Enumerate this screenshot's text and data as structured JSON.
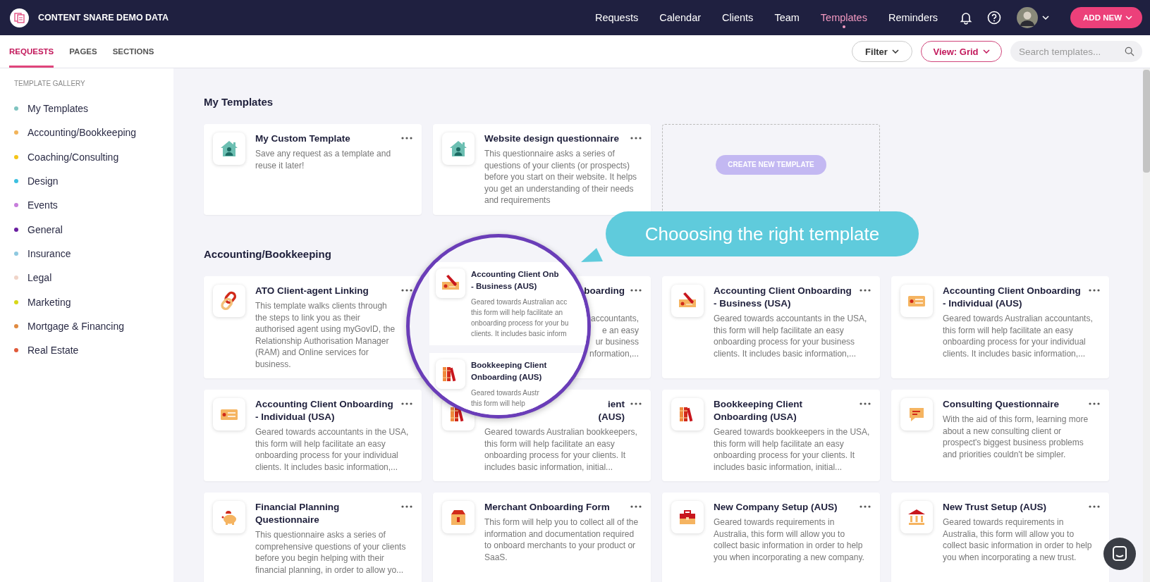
{
  "app": {
    "title": "CONTENT SNARE DEMO DATA"
  },
  "nav": [
    {
      "label": "Requests",
      "selected": false
    },
    {
      "label": "Calendar",
      "selected": false
    },
    {
      "label": "Clients",
      "selected": false
    },
    {
      "label": "Team",
      "selected": false
    },
    {
      "label": "Templates",
      "selected": true
    },
    {
      "label": "Reminders",
      "selected": false
    }
  ],
  "add_new_button": "ADD NEW",
  "sub_tabs": [
    {
      "label": "REQUESTS",
      "selected": true
    },
    {
      "label": "PAGES",
      "selected": false
    },
    {
      "label": "SECTIONS",
      "selected": false
    }
  ],
  "filter_button": "Filter",
  "view_button": "View: Grid",
  "search": {
    "placeholder": "Search templates..."
  },
  "sidebar": {
    "heading": "TEMPLATE GALLERY",
    "items": [
      {
        "label": "My Templates",
        "color": "#7fc4c0"
      },
      {
        "label": "Accounting/Bookkeeping",
        "color": "#f2b45a"
      },
      {
        "label": "Coaching/Consulting",
        "color": "#f5c518"
      },
      {
        "label": "Design",
        "color": "#3cc0e0"
      },
      {
        "label": "Events",
        "color": "#c77ddb"
      },
      {
        "label": "General",
        "color": "#6a1fa0"
      },
      {
        "label": "Insurance",
        "color": "#8ec9e0"
      },
      {
        "label": "Legal",
        "color": "#f0d4c8"
      },
      {
        "label": "Marketing",
        "color": "#d8d818"
      },
      {
        "label": "Mortgage & Financing",
        "color": "#e08a40"
      },
      {
        "label": "Real Estate",
        "color": "#e05a3a"
      }
    ]
  },
  "sections": [
    {
      "title": "My Templates",
      "create_button": "CREATE NEW TEMPLATE",
      "cards": [
        {
          "kind": "full",
          "title": "My Custom Template",
          "description": "Save any request as a template and reuse it later!"
        },
        {
          "kind": "full",
          "title": "Website design questionnaire",
          "description": "This questionnaire asks a series of questions of your clients (or prospects) before you start on their website. It helps you get an understanding of their needs and requirements"
        }
      ]
    },
    {
      "title": "Accounting/Bookkeeping",
      "cards": [
        {
          "kind": "full",
          "title": "ATO Client-agent Linking",
          "description": "This template walks clients through the steps to link you as their authorised agent using myGovID, the Relationship Authorisation Manager (RAM) and Online services for business."
        },
        {
          "kind": "covered",
          "title_lines": [
            "boarding"
          ],
          "description_lines": [
            "accountants,",
            "e an easy",
            "ur business",
            "nformation,..."
          ]
        },
        {
          "kind": "full",
          "title": "Accounting Client Onboarding - Business (USA)",
          "description": "Geared towards accountants in the USA, this form will help facilitate an easy onboarding process for your business clients. It includes basic information,..."
        },
        {
          "kind": "full",
          "title": "Accounting Client Onboarding - Individual (AUS)",
          "description": "Geared towards Australian accountants, this form will help facilitate an easy onboarding process for your individual clients. It includes basic information,..."
        },
        {
          "kind": "full",
          "title": "Accounting Client Onboarding - Individual (USA)",
          "description": "Geared towards accountants in the USA, this form will help facilitate an easy onboarding process for your individual clients. It includes basic information,..."
        },
        {
          "kind": "covered",
          "title_lines": [
            "ient",
            "(AUS)"
          ],
          "description": "Geared towards Australian bookkeepers, this form will help facilitate an easy onboarding process for your clients. It includes basic information, initial..."
        },
        {
          "kind": "full",
          "title": "Bookkeeping Client Onboarding (USA)",
          "description": "Geared towards bookkeepers in the USA, this form will help facilitate an easy onboarding process for your clients. It includes basic information, initial..."
        },
        {
          "kind": "full",
          "title": "Consulting Questionnaire",
          "description": "With the aid of this form, learning more about a new consulting client or prospect's biggest business problems and priorities couldn't be simpler."
        },
        {
          "kind": "full",
          "title": "Financial Planning Questionnaire",
          "description": "This questionnaire asks a series of comprehensive questions of your clients before you begin helping with their financial planning, in order to allow yo..."
        },
        {
          "kind": "full",
          "title": "Merchant Onboarding Form",
          "description": "This form will help you to collect all of the information and documentation required to onboard merchants to your product or SaaS."
        },
        {
          "kind": "full",
          "title": "New Company Setup (AUS)",
          "description": "Geared towards requirements in Australia, this form will allow you to collect basic information in order to help you when incorporating a new company."
        },
        {
          "kind": "full",
          "title": "New Trust Setup (AUS)",
          "description": "Geared towards requirements in Australia, this form will allow you to collect basic information in order to help you when incorporating a new trust."
        }
      ]
    }
  ],
  "callout": "Chooosing the right template",
  "magnifier": {
    "cards": [
      {
        "title_lines": [
          "Accounting Client Onb",
          "- Business (AUS)"
        ],
        "description_lines": [
          "Geared towards Australian acc",
          "this form will help facilitate an",
          "onboarding process for your bu",
          "clients. It includes basic inform"
        ]
      },
      {
        "title_lines": [
          "Bookkeeping Client",
          "Onboarding (AUS)"
        ],
        "description_lines": [
          "Geared towards Austr",
          "this form will help"
        ]
      }
    ]
  }
}
